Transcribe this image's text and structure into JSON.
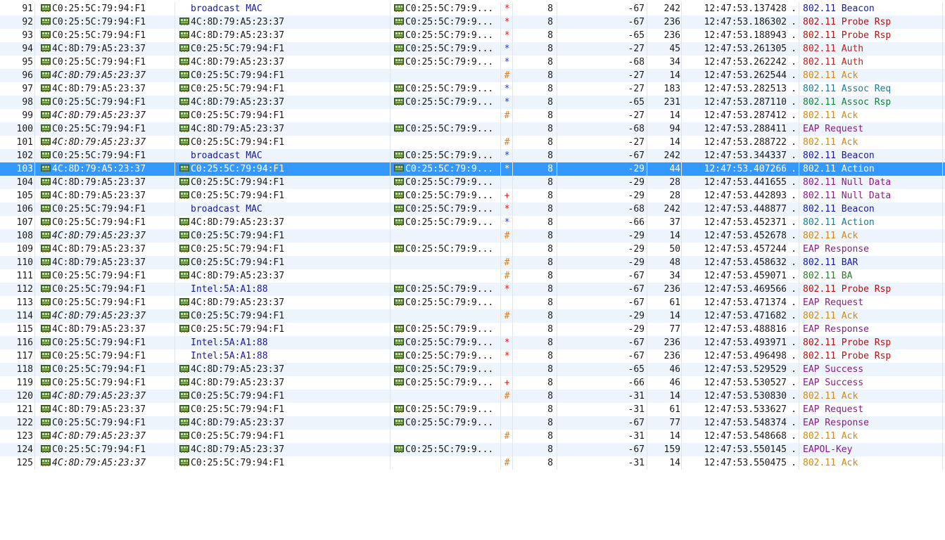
{
  "colors": {
    "flag_red": "#e02020",
    "flag_blue": "#2a40c8",
    "flag_orange": "#e08020",
    "proto_blue": "#1a1a9a",
    "proto_darkred": "#b01515",
    "proto_red": "#c02020",
    "proto_teal": "#1a7a9a",
    "proto_green": "#1a8040",
    "proto_orange": "#d08a1a",
    "proto_purple": "#8a1a8a",
    "proto_darkgreen": "#2a7a2a",
    "selected_bg": "#3399ff",
    "alt_row_bg": "#eef4fb",
    "dst_text_blue": "#1a1a90"
  },
  "packets": [
    {
      "no": "91",
      "src": "C0:25:5C:79:94:F1",
      "src_italic": false,
      "dst": "broadcast MAC",
      "dst_blue": true,
      "bssid": "C0:25:5C:79:9...",
      "flag": "*",
      "flag_color": "red",
      "channel": "8",
      "signal": "-67",
      "length": "242",
      "timestamp": "12:47:53.137428",
      "dot": ".",
      "proto": "802.11",
      "info": "Beacon",
      "proto_color": "blue"
    },
    {
      "no": "92",
      "src": "C0:25:5C:79:94:F1",
      "src_italic": false,
      "dst": "4C:8D:79:A5:23:37",
      "dst_blue": false,
      "bssid": "C0:25:5C:79:9...",
      "flag": "*",
      "flag_color": "red",
      "channel": "8",
      "signal": "-67",
      "length": "236",
      "timestamp": "12:47:53.186302",
      "dot": ".",
      "proto": "802.11",
      "info": "Probe Rsp",
      "proto_color": "darkred"
    },
    {
      "no": "93",
      "src": "C0:25:5C:79:94:F1",
      "src_italic": false,
      "dst": "4C:8D:79:A5:23:37",
      "dst_blue": false,
      "bssid": "C0:25:5C:79:9...",
      "flag": "*",
      "flag_color": "red",
      "channel": "8",
      "signal": "-65",
      "length": "236",
      "timestamp": "12:47:53.188943",
      "dot": ".",
      "proto": "802.11",
      "info": "Probe Rsp",
      "proto_color": "darkred"
    },
    {
      "no": "94",
      "src": "4C:8D:79:A5:23:37",
      "src_italic": false,
      "dst": "C0:25:5C:79:94:F1",
      "dst_blue": false,
      "bssid": "C0:25:5C:79:9...",
      "flag": "*",
      "flag_color": "blue",
      "channel": "8",
      "signal": "-27",
      "length": "45",
      "timestamp": "12:47:53.261305",
      "dot": ".",
      "proto": "802.11",
      "info": "Auth",
      "proto_color": "red"
    },
    {
      "no": "95",
      "src": "C0:25:5C:79:94:F1",
      "src_italic": false,
      "dst": "4C:8D:79:A5:23:37",
      "dst_blue": false,
      "bssid": "C0:25:5C:79:9...",
      "flag": "*",
      "flag_color": "blue",
      "channel": "8",
      "signal": "-68",
      "length": "34",
      "timestamp": "12:47:53.262242",
      "dot": ".",
      "proto": "802.11",
      "info": "Auth",
      "proto_color": "red"
    },
    {
      "no": "96",
      "src": "4C:8D:79:A5:23:37",
      "src_italic": true,
      "dst": "C0:25:5C:79:94:F1",
      "dst_blue": false,
      "bssid": "",
      "flag": "#",
      "flag_color": "orange",
      "channel": "8",
      "signal": "-27",
      "length": "14",
      "timestamp": "12:47:53.262544",
      "dot": ".",
      "proto": "802.11",
      "info": "Ack",
      "proto_color": "orange"
    },
    {
      "no": "97",
      "src": "4C:8D:79:A5:23:37",
      "src_italic": false,
      "dst": "C0:25:5C:79:94:F1",
      "dst_blue": false,
      "bssid": "C0:25:5C:79:9...",
      "flag": "*",
      "flag_color": "blue",
      "channel": "8",
      "signal": "-27",
      "length": "183",
      "timestamp": "12:47:53.282513",
      "dot": ".",
      "proto": "802.11",
      "info": "Assoc Req",
      "proto_color": "teal"
    },
    {
      "no": "98",
      "src": "C0:25:5C:79:94:F1",
      "src_italic": false,
      "dst": "4C:8D:79:A5:23:37",
      "dst_blue": false,
      "bssid": "C0:25:5C:79:9...",
      "flag": "*",
      "flag_color": "blue",
      "channel": "8",
      "signal": "-65",
      "length": "231",
      "timestamp": "12:47:53.287110",
      "dot": ".",
      "proto": "802.11",
      "info": "Assoc Rsp",
      "proto_color": "green"
    },
    {
      "no": "99",
      "src": "4C:8D:79:A5:23:37",
      "src_italic": true,
      "dst": "C0:25:5C:79:94:F1",
      "dst_blue": false,
      "bssid": "",
      "flag": "#",
      "flag_color": "orange",
      "channel": "8",
      "signal": "-27",
      "length": "14",
      "timestamp": "12:47:53.287412",
      "dot": ".",
      "proto": "802.11",
      "info": "Ack",
      "proto_color": "orange"
    },
    {
      "no": "100",
      "src": "C0:25:5C:79:94:F1",
      "src_italic": false,
      "dst": "4C:8D:79:A5:23:37",
      "dst_blue": false,
      "bssid": "C0:25:5C:79:9...",
      "flag": "",
      "flag_color": "",
      "channel": "8",
      "signal": "-68",
      "length": "94",
      "timestamp": "12:47:53.288411",
      "dot": ".",
      "proto": "",
      "info": "EAP Request",
      "proto_color": "purple"
    },
    {
      "no": "101",
      "src": "4C:8D:79:A5:23:37",
      "src_italic": true,
      "dst": "C0:25:5C:79:94:F1",
      "dst_blue": false,
      "bssid": "",
      "flag": "#",
      "flag_color": "orange",
      "channel": "8",
      "signal": "-27",
      "length": "14",
      "timestamp": "12:47:53.288722",
      "dot": ".",
      "proto": "802.11",
      "info": "Ack",
      "proto_color": "orange"
    },
    {
      "no": "102",
      "src": "C0:25:5C:79:94:F1",
      "src_italic": false,
      "dst": "broadcast MAC",
      "dst_blue": true,
      "bssid": "C0:25:5C:79:9...",
      "flag": "*",
      "flag_color": "blue",
      "channel": "8",
      "signal": "-67",
      "length": "242",
      "timestamp": "12:47:53.344337",
      "dot": ".",
      "proto": "802.11",
      "info": "Beacon",
      "proto_color": "blue"
    },
    {
      "no": "103",
      "src": "4C:8D:79:A5:23:37",
      "src_italic": false,
      "dst": "C0:25:5C:79:94:F1",
      "dst_blue": false,
      "bssid": "C0:25:5C:79:9...",
      "flag": "*",
      "flag_color": "white",
      "channel": "8",
      "signal": "-29",
      "length": "44",
      "timestamp": "12:47:53.407266",
      "dot": ".",
      "proto": "802.11",
      "info": "Action",
      "proto_color": "white",
      "selected": true
    },
    {
      "no": "104",
      "src": "4C:8D:79:A5:23:37",
      "src_italic": false,
      "dst": "C0:25:5C:79:94:F1",
      "dst_blue": false,
      "bssid": "C0:25:5C:79:9...",
      "flag": "",
      "flag_color": "",
      "channel": "8",
      "signal": "-29",
      "length": "28",
      "timestamp": "12:47:53.441655",
      "dot": ".",
      "proto": "802.11",
      "info": "Null Data",
      "proto_color": "purple"
    },
    {
      "no": "105",
      "src": "4C:8D:79:A5:23:37",
      "src_italic": false,
      "dst": "C0:25:5C:79:94:F1",
      "dst_blue": false,
      "bssid": "C0:25:5C:79:9...",
      "flag": "+",
      "flag_color": "red",
      "channel": "8",
      "signal": "-29",
      "length": "28",
      "timestamp": "12:47:53.442893",
      "dot": ".",
      "proto": "802.11",
      "info": "Null Data",
      "proto_color": "purple"
    },
    {
      "no": "106",
      "src": "C0:25:5C:79:94:F1",
      "src_italic": false,
      "dst": "broadcast MAC",
      "dst_blue": true,
      "bssid": "C0:25:5C:79:9...",
      "flag": "*",
      "flag_color": "red",
      "channel": "8",
      "signal": "-68",
      "length": "242",
      "timestamp": "12:47:53.448877",
      "dot": ".",
      "proto": "802.11",
      "info": "Beacon",
      "proto_color": "blue"
    },
    {
      "no": "107",
      "src": "C0:25:5C:79:94:F1",
      "src_italic": false,
      "dst": "4C:8D:79:A5:23:37",
      "dst_blue": false,
      "bssid": "C0:25:5C:79:9...",
      "flag": "*",
      "flag_color": "blue",
      "channel": "8",
      "signal": "-66",
      "length": "37",
      "timestamp": "12:47:53.452371",
      "dot": ".",
      "proto": "802.11",
      "info": "Action",
      "proto_color": "teal"
    },
    {
      "no": "108",
      "src": "4C:8D:79:A5:23:37",
      "src_italic": true,
      "dst": "C0:25:5C:79:94:F1",
      "dst_blue": false,
      "bssid": "",
      "flag": "#",
      "flag_color": "orange",
      "channel": "8",
      "signal": "-29",
      "length": "14",
      "timestamp": "12:47:53.452678",
      "dot": ".",
      "proto": "802.11",
      "info": "Ack",
      "proto_color": "orange"
    },
    {
      "no": "109",
      "src": "4C:8D:79:A5:23:37",
      "src_italic": false,
      "dst": "C0:25:5C:79:94:F1",
      "dst_blue": false,
      "bssid": "C0:25:5C:79:9...",
      "flag": "",
      "flag_color": "",
      "channel": "8",
      "signal": "-29",
      "length": "50",
      "timestamp": "12:47:53.457244",
      "dot": ".",
      "proto": "",
      "info": "EAP Response",
      "proto_color": "purple"
    },
    {
      "no": "110",
      "src": "4C:8D:79:A5:23:37",
      "src_italic": false,
      "dst": "C0:25:5C:79:94:F1",
      "dst_blue": false,
      "bssid": "",
      "flag": "#",
      "flag_color": "orange",
      "channel": "8",
      "signal": "-29",
      "length": "48",
      "timestamp": "12:47:53.458632",
      "dot": ".",
      "proto": "802.11",
      "info": "BAR",
      "proto_color": "blue"
    },
    {
      "no": "111",
      "src": "C0:25:5C:79:94:F1",
      "src_italic": false,
      "dst": "4C:8D:79:A5:23:37",
      "dst_blue": false,
      "bssid": "",
      "flag": "#",
      "flag_color": "orange",
      "channel": "8",
      "signal": "-67",
      "length": "34",
      "timestamp": "12:47:53.459071",
      "dot": ".",
      "proto": "802.11",
      "info": "BA",
      "proto_color": "darkgreen"
    },
    {
      "no": "112",
      "src": "C0:25:5C:79:94:F1",
      "src_italic": false,
      "dst": "Intel:5A:A1:88",
      "dst_blue": true,
      "bssid": "C0:25:5C:79:9...",
      "flag": "*",
      "flag_color": "red",
      "channel": "8",
      "signal": "-67",
      "length": "236",
      "timestamp": "12:47:53.469566",
      "dot": ".",
      "proto": "802.11",
      "info": "Probe Rsp",
      "proto_color": "darkred"
    },
    {
      "no": "113",
      "src": "C0:25:5C:79:94:F1",
      "src_italic": false,
      "dst": "4C:8D:79:A5:23:37",
      "dst_blue": false,
      "bssid": "C0:25:5C:79:9...",
      "flag": "",
      "flag_color": "",
      "channel": "8",
      "signal": "-67",
      "length": "61",
      "timestamp": "12:47:53.471374",
      "dot": ".",
      "proto": "",
      "info": "EAP Request",
      "proto_color": "purple"
    },
    {
      "no": "114",
      "src": "4C:8D:79:A5:23:37",
      "src_italic": true,
      "dst": "C0:25:5C:79:94:F1",
      "dst_blue": false,
      "bssid": "",
      "flag": "#",
      "flag_color": "orange",
      "channel": "8",
      "signal": "-29",
      "length": "14",
      "timestamp": "12:47:53.471682",
      "dot": ".",
      "proto": "802.11",
      "info": "Ack",
      "proto_color": "orange"
    },
    {
      "no": "115",
      "src": "4C:8D:79:A5:23:37",
      "src_italic": false,
      "dst": "C0:25:5C:79:94:F1",
      "dst_blue": false,
      "bssid": "C0:25:5C:79:9...",
      "flag": "",
      "flag_color": "",
      "channel": "8",
      "signal": "-29",
      "length": "77",
      "timestamp": "12:47:53.488816",
      "dot": ".",
      "proto": "",
      "info": "EAP Response",
      "proto_color": "purple"
    },
    {
      "no": "116",
      "src": "C0:25:5C:79:94:F1",
      "src_italic": false,
      "dst": "Intel:5A:A1:88",
      "dst_blue": true,
      "bssid": "C0:25:5C:79:9...",
      "flag": "*",
      "flag_color": "red",
      "channel": "8",
      "signal": "-67",
      "length": "236",
      "timestamp": "12:47:53.493971",
      "dot": ".",
      "proto": "802.11",
      "info": "Probe Rsp",
      "proto_color": "darkred"
    },
    {
      "no": "117",
      "src": "C0:25:5C:79:94:F1",
      "src_italic": false,
      "dst": "Intel:5A:A1:88",
      "dst_blue": true,
      "bssid": "C0:25:5C:79:9...",
      "flag": "*",
      "flag_color": "red",
      "channel": "8",
      "signal": "-67",
      "length": "236",
      "timestamp": "12:47:53.496498",
      "dot": ".",
      "proto": "802.11",
      "info": "Probe Rsp",
      "proto_color": "darkred"
    },
    {
      "no": "118",
      "src": "C0:25:5C:79:94:F1",
      "src_italic": false,
      "dst": "4C:8D:79:A5:23:37",
      "dst_blue": false,
      "bssid": "C0:25:5C:79:9...",
      "flag": "",
      "flag_color": "",
      "channel": "8",
      "signal": "-65",
      "length": "46",
      "timestamp": "12:47:53.529529",
      "dot": ".",
      "proto": "",
      "info": "EAP Success",
      "proto_color": "purple"
    },
    {
      "no": "119",
      "src": "C0:25:5C:79:94:F1",
      "src_italic": false,
      "dst": "4C:8D:79:A5:23:37",
      "dst_blue": false,
      "bssid": "C0:25:5C:79:9...",
      "flag": "+",
      "flag_color": "red",
      "channel": "8",
      "signal": "-66",
      "length": "46",
      "timestamp": "12:47:53.530527",
      "dot": ".",
      "proto": "",
      "info": "EAP Success",
      "proto_color": "purple"
    },
    {
      "no": "120",
      "src": "4C:8D:79:A5:23:37",
      "src_italic": true,
      "dst": "C0:25:5C:79:94:F1",
      "dst_blue": false,
      "bssid": "",
      "flag": "#",
      "flag_color": "orange",
      "channel": "8",
      "signal": "-31",
      "length": "14",
      "timestamp": "12:47:53.530830",
      "dot": ".",
      "proto": "802.11",
      "info": "Ack",
      "proto_color": "orange"
    },
    {
      "no": "121",
      "src": "4C:8D:79:A5:23:37",
      "src_italic": false,
      "dst": "C0:25:5C:79:94:F1",
      "dst_blue": false,
      "bssid": "C0:25:5C:79:9...",
      "flag": "",
      "flag_color": "",
      "channel": "8",
      "signal": "-31",
      "length": "61",
      "timestamp": "12:47:53.533627",
      "dot": ".",
      "proto": "",
      "info": "EAP Request",
      "proto_color": "purple"
    },
    {
      "no": "122",
      "src": "C0:25:5C:79:94:F1",
      "src_italic": false,
      "dst": "4C:8D:79:A5:23:37",
      "dst_blue": false,
      "bssid": "C0:25:5C:79:9...",
      "flag": "",
      "flag_color": "",
      "channel": "8",
      "signal": "-67",
      "length": "77",
      "timestamp": "12:47:53.548374",
      "dot": ".",
      "proto": "",
      "info": "EAP Response",
      "proto_color": "purple"
    },
    {
      "no": "123",
      "src": "4C:8D:79:A5:23:37",
      "src_italic": true,
      "dst": "C0:25:5C:79:94:F1",
      "dst_blue": false,
      "bssid": "",
      "flag": "#",
      "flag_color": "orange",
      "channel": "8",
      "signal": "-31",
      "length": "14",
      "timestamp": "12:47:53.548668",
      "dot": ".",
      "proto": "802.11",
      "info": "Ack",
      "proto_color": "orange"
    },
    {
      "no": "124",
      "src": "C0:25:5C:79:94:F1",
      "src_italic": false,
      "dst": "4C:8D:79:A5:23:37",
      "dst_blue": false,
      "bssid": "C0:25:5C:79:9...",
      "flag": "",
      "flag_color": "",
      "channel": "8",
      "signal": "-67",
      "length": "159",
      "timestamp": "12:47:53.550145",
      "dot": ".",
      "proto": "",
      "info": "EAPOL-Key",
      "proto_color": "purple"
    },
    {
      "no": "125",
      "src": "4C:8D:79:A5:23:37",
      "src_italic": true,
      "dst": "C0:25:5C:79:94:F1",
      "dst_blue": false,
      "bssid": "",
      "flag": "#",
      "flag_color": "orange",
      "channel": "8",
      "signal": "-31",
      "length": "14",
      "timestamp": "12:47:53.550475",
      "dot": ".",
      "proto": "802.11",
      "info": "Ack",
      "proto_color": "orange"
    }
  ]
}
